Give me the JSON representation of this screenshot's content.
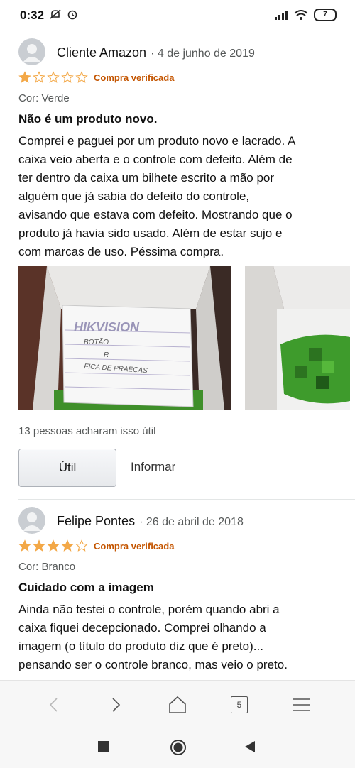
{
  "status": {
    "time": "0:32",
    "battery": "7"
  },
  "reviews": [
    {
      "name": "Cliente Amazon",
      "date": "· 4 de junho de 2019",
      "rating": 1,
      "verified": "Compra verificada",
      "variant": "Cor: Verde",
      "title": "Não é um produto novo.",
      "body_lines": [
        "Comprei e paguei por um produto novo e lacrado. A",
        "caixa veio aberta e o controle com defeito. Além de",
        "ter dentro da caixa um bilhete escrito a mão por",
        "alguém que já sabia do defeito do controle,",
        "avisando que estava com defeito. Mostrando que o",
        "produto já havia sido usado. Além de estar sujo e",
        "com marcas de uso. Péssima compra."
      ],
      "note_text": [
        "HIKVISION",
        "BOTÃO",
        "R",
        "FICA DE PRAECAS"
      ],
      "helpful_count": "13 pessoas acharam isso útil",
      "helpful_label": "Útil",
      "report_label": "Informar"
    },
    {
      "name": "Felipe Pontes",
      "date": "· 26 de abril de 2018",
      "rating": 4,
      "verified": "Compra verificada",
      "variant": "Cor: Branco",
      "title": "Cuidado com a imagem",
      "body_lines": [
        "Ainda não testei o controle, porém quando abri a",
        "caixa fiquei decepcionado. Comprei olhando a",
        "imagem (o título do produto diz que é preto)...",
        "pensando ser o controle branco, mas veio o preto."
      ]
    }
  ],
  "browser": {
    "tabs_count": "5"
  },
  "colors": {
    "star": "#f3a847",
    "verified": "#c45500"
  },
  "icons": [
    "do-not-disturb-icon",
    "alarm-icon",
    "signal-icon",
    "wifi-icon",
    "battery-icon",
    "back-icon",
    "forward-icon",
    "home-icon",
    "tabs-icon",
    "menu-icon",
    "recents-icon",
    "system-home-icon",
    "system-back-icon",
    "avatar-icon"
  ]
}
